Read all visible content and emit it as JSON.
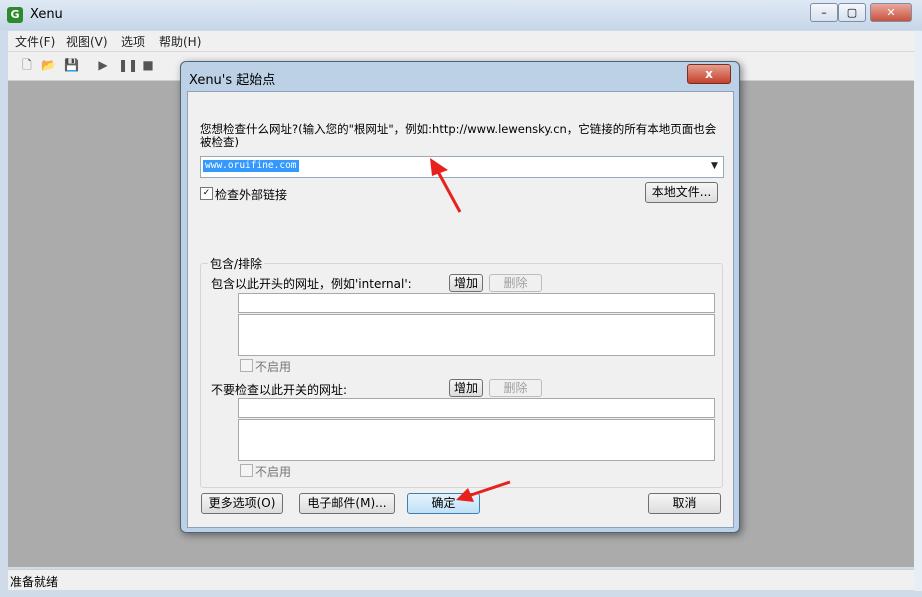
{
  "app": {
    "title": "Xenu",
    "icon": "xenu-frog-icon"
  },
  "menu": [
    "文件(F)",
    "视图(V)",
    "选项",
    "帮助(H)"
  ],
  "toolbar": {
    "icons": [
      "new-file-icon",
      "open-folder-icon",
      "save-icon",
      "play-icon",
      "pause-icon",
      "stop-icon"
    ]
  },
  "status": {
    "text": "准备就绪"
  },
  "dialog": {
    "title": "Xenu's 起始点",
    "close_label": "x",
    "prompt": "您想检查什么网址?(输入您的\"根网址\"，例如:http://www.lewensky.cn，它链接的所有本地页面也会被检查)",
    "url_value": "www.oruifine.com",
    "check_external_label": "检查外部链接",
    "check_external_checked": true,
    "local_file_button": "本地文件...",
    "group_title": "包含/排除",
    "include": {
      "label": "包含以此开头的网址，例如'internal':",
      "add_button": "增加",
      "delete_button": "删除",
      "input_value": "",
      "disable_label": "不启用"
    },
    "exclude": {
      "label": "不要检查以此开关的网址:",
      "add_button": "增加",
      "delete_button": "删除",
      "input_value": "",
      "disable_label": "不启用"
    },
    "more_options_button": "更多选项(O)",
    "email_button": "电子邮件(M)...",
    "ok_button": "确定",
    "cancel_button": "取消"
  },
  "colors": {
    "annotation_arrow": "#e8211c",
    "selection": "#3399ff"
  }
}
